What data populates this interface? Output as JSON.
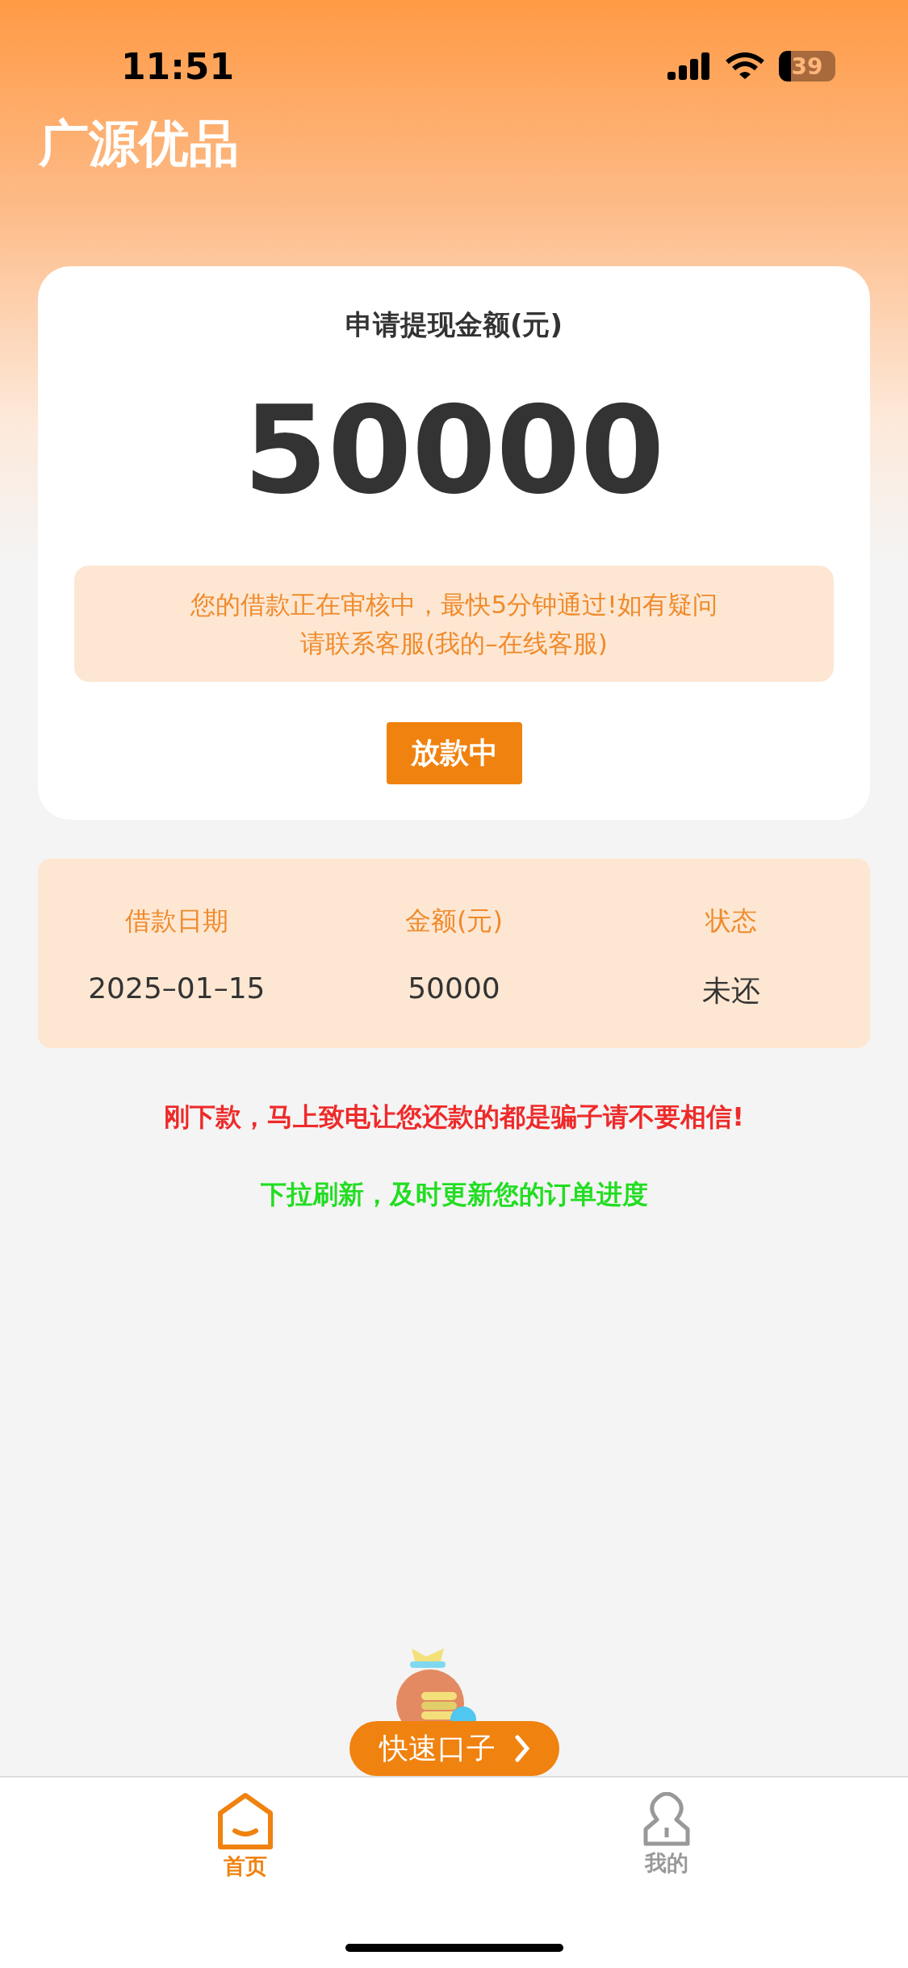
{
  "status_bar": {
    "time": "11:51",
    "battery": "39"
  },
  "header": {
    "title": "广源优品"
  },
  "apply_card": {
    "label": "申请提现金额(元)",
    "amount": "50000",
    "notice": [
      "您的借款正在审核中，最快5分钟通过!如有疑问",
      "请联系客服(我的–在线客服)"
    ],
    "status_button": "放款中"
  },
  "loan_table": {
    "columns": [
      "借款日期",
      "金额(元)",
      "状态"
    ],
    "rows": [
      [
        "2025–01–15",
        "50000",
        "未还"
      ]
    ]
  },
  "warnings": [
    {
      "text": "刚下款，马上致电让您还款的都是骗子请不要相信!",
      "color": "#ee2a2a"
    },
    {
      "text": "下拉刷新，及时更新您的订单进度",
      "color": "#22dd22"
    }
  ],
  "promo_button": {
    "label": "快速口子"
  },
  "tab_bar": [
    {
      "label": "首页",
      "kind": "home",
      "selected": true
    },
    {
      "label": "我的",
      "kind": "profile",
      "selected": false
    }
  ]
}
